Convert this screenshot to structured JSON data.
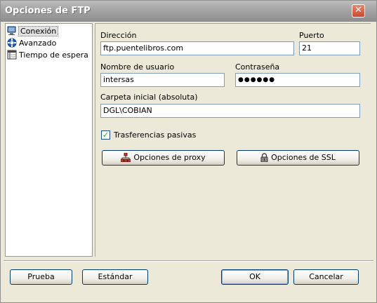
{
  "window": {
    "title": "Opciones de FTP",
    "close_glyph": "✕"
  },
  "tree": {
    "items": [
      {
        "label": "Conexión",
        "icon": "connection-icon",
        "selected": true
      },
      {
        "label": "Avanzado",
        "icon": "advanced-icon",
        "selected": false
      },
      {
        "label": "Tiempo de espera",
        "icon": "timeout-icon",
        "selected": false
      }
    ]
  },
  "form": {
    "address_label": "Dirección",
    "address_value": "ftp.puentelibros.com",
    "port_label": "Puerto",
    "port_value": "21",
    "username_label": "Nombre de usuario",
    "username_value": "intersas",
    "password_label": "Contraseña",
    "password_value": "●●●●●●",
    "folder_label": "Carpeta inicial (absoluta)",
    "folder_value": "DGL\\COBIAN",
    "passive_label": "Trasferencias pasivas",
    "passive_checked": true,
    "proxy_button": "Opciones de proxy",
    "ssl_button": "Opciones de SSL"
  },
  "footer": {
    "test_button": "Prueba",
    "standard_button": "Estándar",
    "ok_button": "OK",
    "cancel_button": "Cancelar"
  },
  "colors": {
    "accent": "#003c74",
    "check": "#21a121"
  }
}
